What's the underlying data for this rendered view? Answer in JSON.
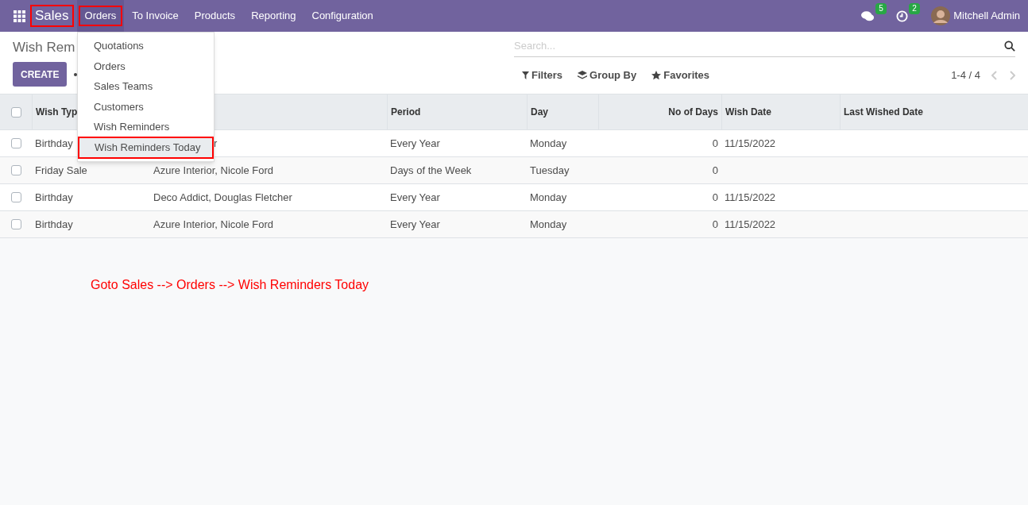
{
  "navbar": {
    "app": {
      "label": "Sales",
      "highlighted": true
    },
    "menus": [
      {
        "label": "Orders",
        "open": true,
        "highlighted": true
      },
      {
        "label": "To Invoice",
        "open": false,
        "highlighted": false
      },
      {
        "label": "Products",
        "open": false,
        "highlighted": false
      },
      {
        "label": "Reporting",
        "open": false,
        "highlighted": false
      },
      {
        "label": "Configuration",
        "open": false,
        "highlighted": false
      }
    ],
    "messages_badge": "5",
    "activities_badge": "2",
    "user": "Mitchell Admin"
  },
  "dropdown": {
    "items": [
      {
        "label": "Quotations",
        "highlighted": false
      },
      {
        "label": "Orders",
        "highlighted": false
      },
      {
        "label": "Sales Teams",
        "highlighted": false
      },
      {
        "label": "Customers",
        "highlighted": false
      },
      {
        "label": "Wish Reminders",
        "highlighted": false
      },
      {
        "label": "Wish Reminders Today",
        "highlighted": true
      }
    ]
  },
  "control_panel": {
    "title": "Wish Rem",
    "create_button": "CREATE",
    "search": {
      "placeholder": "Search..."
    },
    "filters": "Filters",
    "group_by": "Group By",
    "favorites": "Favorites",
    "pager": "1-4 / 4"
  },
  "table": {
    "all_checked": false,
    "columns": [
      {
        "label": "Wish Typ"
      },
      {},
      {
        "label": "Period"
      },
      {
        "label": "Day"
      },
      {
        "label": "No of Days"
      },
      {
        "label": "Wish Date"
      },
      {
        "label": "Last Wished Date"
      }
    ],
    "rows": [
      {
        "cells": [
          "Birthday",
          "r",
          "Every Year",
          "Monday",
          "0",
          "11/15/2022",
          ""
        ],
        "covered": true,
        "checked": false
      },
      {
        "cells": [
          "Friday Sale",
          "Azure Interior, Nicole Ford",
          "Days of the Week",
          "Tuesday",
          "0",
          "",
          ""
        ],
        "checked": false
      },
      {
        "cells": [
          "Birthday",
          "Deco Addict, Douglas Fletcher",
          "Every Year",
          "Monday",
          "0",
          "11/15/2022",
          ""
        ],
        "checked": false
      },
      {
        "cells": [
          "Birthday",
          "Azure Interior, Nicole Ford",
          "Every Year",
          "Monday",
          "0",
          "11/15/2022",
          ""
        ],
        "checked": false
      }
    ]
  },
  "annotation": "Goto Sales --> Orders --> Wish Reminders Today"
}
